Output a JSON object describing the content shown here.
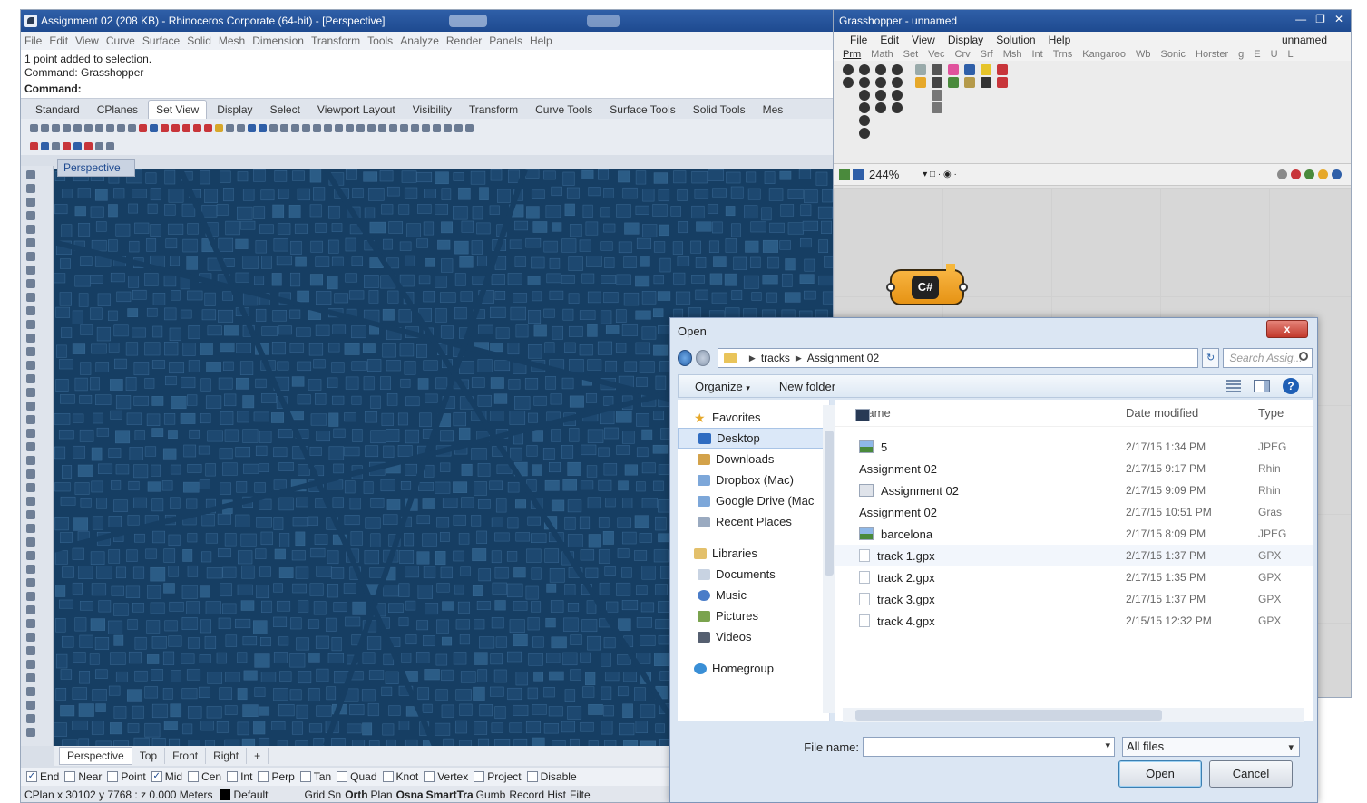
{
  "rhino": {
    "title": "Assignment 02 (208 KB) - Rhinoceros Corporate (64-bit) - [Perspective]",
    "menu": [
      "File",
      "Edit",
      "View",
      "Curve",
      "Surface",
      "Solid",
      "Mesh",
      "Dimension",
      "Transform",
      "Tools",
      "Analyze",
      "Render",
      "Panels",
      "Help"
    ],
    "history_line1": "1 point added to selection.",
    "history_line2": "Command: Grasshopper",
    "command_prompt": "Command:",
    "toolbar_tabs": [
      "Standard",
      "CPlanes",
      "Set View",
      "Display",
      "Select",
      "Viewport Layout",
      "Visibility",
      "Transform",
      "Curve Tools",
      "Surface Tools",
      "Solid Tools",
      "Mes"
    ],
    "active_toolbar_tab": "Set View",
    "viewport_title": "Perspective",
    "viewport_tabs": [
      "Perspective",
      "Top",
      "Front",
      "Right",
      "+"
    ],
    "osnaps": [
      {
        "label": "End",
        "checked": true
      },
      {
        "label": "Near",
        "checked": false
      },
      {
        "label": "Point",
        "checked": false
      },
      {
        "label": "Mid",
        "checked": true
      },
      {
        "label": "Cen",
        "checked": false
      },
      {
        "label": "Int",
        "checked": false
      },
      {
        "label": "Perp",
        "checked": false
      },
      {
        "label": "Tan",
        "checked": false
      },
      {
        "label": "Quad",
        "checked": false
      },
      {
        "label": "Knot",
        "checked": false
      },
      {
        "label": "Vertex",
        "checked": false
      },
      {
        "label": "Project",
        "checked": false
      },
      {
        "label": "Disable",
        "checked": false
      }
    ],
    "status": {
      "coords": "CPlan x 30102 y 7768 : z 0.000",
      "units": "Meters",
      "layer": "Default",
      "toggles": [
        "Grid Sn",
        "Orth",
        "Plan",
        "Osna",
        "SmartTra",
        "Gumb",
        "Record Hist",
        "Filte"
      ]
    },
    "viewport_color": "#163e63"
  },
  "gh": {
    "title": "Grasshopper - unnamed",
    "menu": [
      "File",
      "Edit",
      "View",
      "Display",
      "Solution",
      "Help"
    ],
    "doc_name": "unnamed",
    "tabs": [
      "Prm",
      "Math",
      "Set",
      "Vec",
      "Crv",
      "Srf",
      "Msh",
      "Int",
      "Trns",
      "Kangaroo",
      "Wb",
      "Sonic",
      "Horster",
      "g",
      "E",
      "U",
      "L"
    ],
    "zoom": "244%",
    "component_label": "C#"
  },
  "dialog": {
    "title": "Open",
    "close_label": "x",
    "path": [
      "tracks",
      "Assignment 02"
    ],
    "search_placeholder": "Search Assig...",
    "organize": "Organize",
    "new_folder": "New folder",
    "nav": {
      "favorites": "Favorites",
      "favorite_items": [
        "Desktop",
        "Downloads",
        "Dropbox (Mac)",
        "Google Drive (Mac",
        "Recent Places"
      ],
      "libraries": "Libraries",
      "library_items": [
        "Documents",
        "Music",
        "Pictures",
        "Videos"
      ],
      "homegroup": "Homegroup"
    },
    "columns": {
      "name": "Name",
      "date": "Date modified",
      "type": "Type"
    },
    "files": [
      {
        "name": "5",
        "date": "2/17/15 1:34 PM",
        "type": "JPEG",
        "icon": "image-icon"
      },
      {
        "name": "Assignment 02",
        "date": "2/17/15 9:17 PM",
        "type": "Rhin",
        "icon": "rhino-file-icon"
      },
      {
        "name": "Assignment 02",
        "date": "2/17/15 9:09 PM",
        "type": "Rhin",
        "icon": "rhino-backup-icon"
      },
      {
        "name": "Assignment 02",
        "date": "2/17/15 10:51 PM",
        "type": "Gras",
        "icon": "grasshopper-file-icon"
      },
      {
        "name": "barcelona",
        "date": "2/17/15 8:09 PM",
        "type": "JPEG",
        "icon": "image-icon"
      },
      {
        "name": "track 1.gpx",
        "date": "2/17/15 1:37 PM",
        "type": "GPX",
        "icon": "document-icon"
      },
      {
        "name": "track 2.gpx",
        "date": "2/17/15 1:35 PM",
        "type": "GPX",
        "icon": "document-icon"
      },
      {
        "name": "track 3.gpx",
        "date": "2/17/15 1:37 PM",
        "type": "GPX",
        "icon": "document-icon"
      },
      {
        "name": "track 4.gpx",
        "date": "2/15/15 12:32 PM",
        "type": "GPX",
        "icon": "document-icon"
      }
    ],
    "file_name_label": "File name:",
    "file_name_value": "",
    "file_type": "All files",
    "open_button": "Open",
    "cancel_button": "Cancel"
  }
}
